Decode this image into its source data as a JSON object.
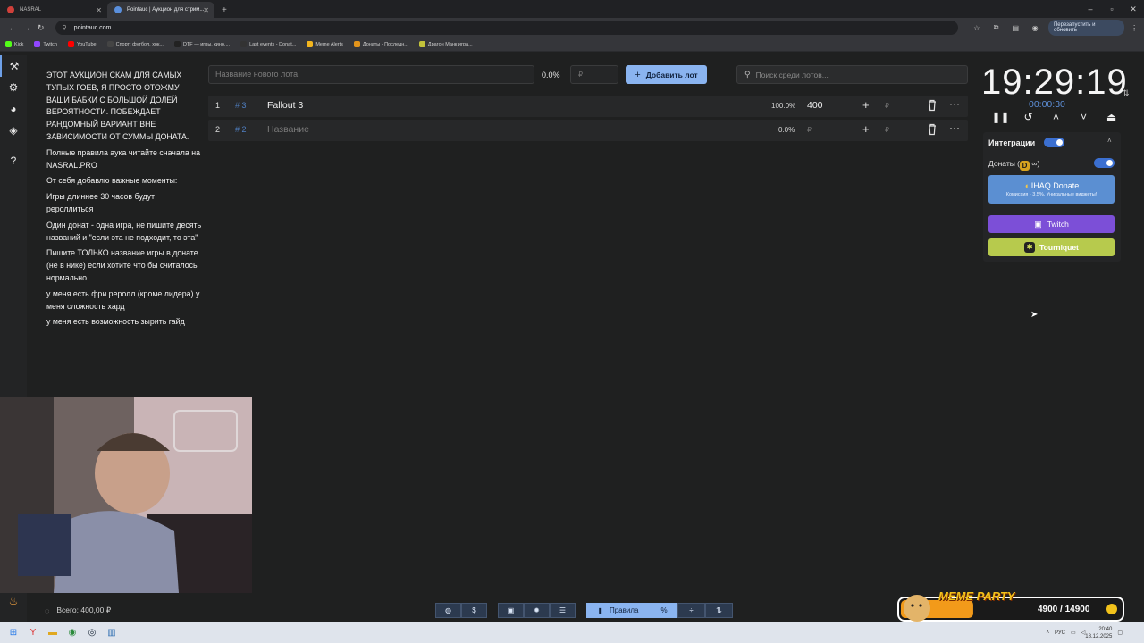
{
  "browser": {
    "tabs": [
      {
        "title": "NASRAL",
        "active": false
      },
      {
        "title": "Pointauc | Аукцион для стрим...",
        "active": true
      }
    ],
    "url": "pointauc.com",
    "relaunch_label": "Перезапустить и обновить",
    "bookmarks": [
      "Kick",
      "Twitch",
      "YouTube",
      "Спорт: футбол, хок...",
      "DTF — игры, кино,...",
      "Last events - Donat...",
      "Meme Alerts",
      "Донаты - Последн...",
      "Драгон Манк игра..."
    ]
  },
  "rules": {
    "paragraphs": [
      "ЭТОТ АУКЦИОН СКАМ ДЛЯ САМЫХ ТУПЫХ ГОЕВ, Я ПРОСТО ОТОЖМУ ВАШИ БАБКИ С БОЛЬШОЙ ДОЛЕЙ ВЕРОЯТНОСТИ. ПОБЕЖДАЕТ РАНДОМНЫЙ ВАРИАНТ ВНЕ ЗАВИСИМОСТИ ОТ СУММЫ ДОНАТА.",
      "Полные правила аука читайте сначала на NASRAL.PRO",
      "От себя добавлю важные моменты:",
      "Игры длиннее 30 часов будут рероллиться",
      "Один донат - одна игра, не пишите десять названий и \"если эта не подходит, то эта\"",
      "Пишите ТОЛЬКО название игры в донате (не в нике) если хотите что бы считалось нормально",
      "у меня есть фри реролл (кроме лидера) у меня сложность хард",
      "у меня есть возможность зырить гайд"
    ]
  },
  "new_lot": {
    "name_placeholder": "Название нового лота",
    "percent": "0.0%",
    "amount_placeholder": "₽",
    "add_label": "Добавить лот"
  },
  "search": {
    "placeholder": "Поиск среди лотов..."
  },
  "lots": [
    {
      "index": "1",
      "id": "# 3",
      "name": "Fallout 3",
      "percent": "100.0%",
      "amount": "400",
      "currency": "₽"
    },
    {
      "index": "2",
      "id": "# 2",
      "name": "Название",
      "percent": "0.0%",
      "amount": "",
      "currency": "₽"
    }
  ],
  "timer": {
    "main": "19:29:19",
    "sub": "00:00:30"
  },
  "integrations": {
    "title": "Интеграции",
    "enabled": true,
    "donations_label": "Донаты (",
    "donations_suffix": ")",
    "donate_service": "IHAQ Donate",
    "donate_sub": "Комиссия - 3,5%. Уникальные виджеты!",
    "twitch_label": "Twitch",
    "tourniquet_label": "Tourniquet"
  },
  "footer": {
    "total": "Всего: 400,00 ₽",
    "rules_label": "Правила"
  },
  "meme_party": {
    "title": "MEME PARTY",
    "progress": "4900 / 14900",
    "fraction": 0.329
  },
  "taskbar": {
    "lang": "РУС",
    "time": "20:40",
    "date": "18.12.2025"
  },
  "colors": {
    "accent": "#8ab4f0",
    "twitch": "#7c4fd7",
    "tourniquet": "#b7ca4d",
    "donate": "#5b8fd2"
  }
}
